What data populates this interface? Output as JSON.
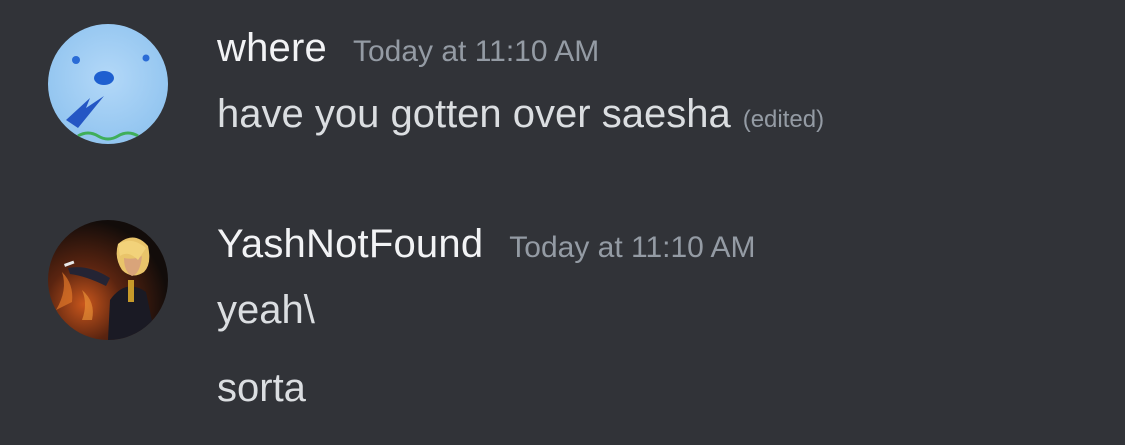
{
  "messages": [
    {
      "author": "where",
      "timestamp": "Today at 11:10 AM",
      "lines": [
        "have you gotten over saesha"
      ],
      "edited_label": "(edited)",
      "avatar": "light-blue-circle-avatar"
    },
    {
      "author": "YashNotFound",
      "timestamp": "Today at 11:10 AM",
      "lines": [
        "yeah\\",
        "sorta"
      ],
      "avatar": "anime-character-avatar"
    }
  ],
  "colors": {
    "background": "#313338",
    "username": "#f2f3f5",
    "message_text": "#dbdee1",
    "muted": "#949ba4"
  }
}
